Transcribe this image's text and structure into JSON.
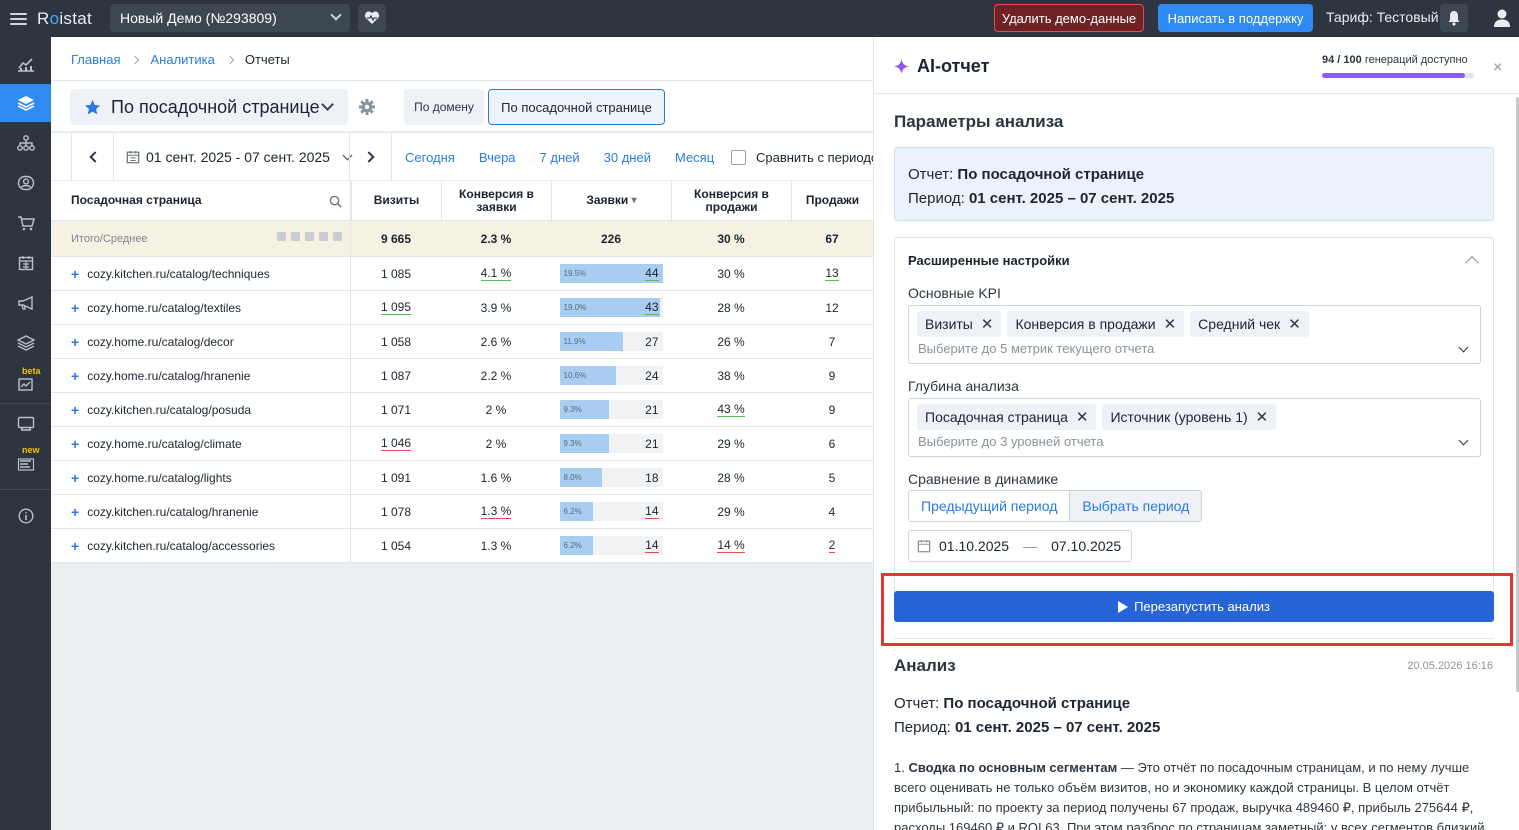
{
  "app": {
    "logo_pre": "R",
    "logo_mid": "o",
    "logo_post": "istat",
    "project": "Новый Демо (№293809)",
    "delete_demo": "Удалить демо-данные",
    "support": "Написать в поддержку",
    "tariff": "Тариф: Тестовый"
  },
  "sidebar": {
    "items": [
      "dashboard-icon",
      "layers-icon",
      "sitemap-icon",
      "leads-icon",
      "cart-icon",
      "calendar-icon",
      "megaphone-icon",
      "stack-icon",
      "ai-chart-icon",
      "bot-icon",
      "list-icon",
      "info-icon"
    ],
    "beta_label": "beta",
    "new_label": "new"
  },
  "breadcrumb": [
    "Главная",
    "Аналитика",
    "Отчеты"
  ],
  "report": {
    "name": "По посадочной странице",
    "tabs": [
      "По домену",
      "По посадочной странице"
    ]
  },
  "daterange": {
    "label": "01 сент. 2025 - 07 сент. 2025",
    "quick": [
      "Сегодня",
      "Вчера",
      "7 дней",
      "30 дней",
      "Месяц"
    ],
    "compare": "Сравнить с периодом"
  },
  "table": {
    "headers": [
      "Посадочная страница",
      "Визиты",
      "Конверсия в заявки",
      "Заявки",
      "Конверсия в продажи",
      "Продажи"
    ],
    "sort_mark": "▾",
    "total": {
      "label": "Итого/Среднее",
      "visits": "9 665",
      "conv_leads": "2.3 %",
      "leads": "226",
      "conv_sales": "30 %",
      "sales": "67"
    },
    "rows": [
      {
        "page": "cozy.kitchen.ru/catalog/techniques",
        "visits": "1 085",
        "conv_leads": "4.1 %",
        "leads_pct": "19.5%",
        "leads": "44",
        "leads_frac": 0.195,
        "conv_sales": "30 %",
        "sales": "13"
      },
      {
        "page": "cozy.home.ru/catalog/textiles",
        "visits": "1 095",
        "conv_leads": "3.9 %",
        "leads_pct": "19.0%",
        "leads": "43",
        "leads_frac": 0.19,
        "conv_sales": "28 %",
        "sales": "12"
      },
      {
        "page": "cozy.home.ru/catalog/decor",
        "visits": "1 058",
        "conv_leads": "2.6 %",
        "leads_pct": "11.9%",
        "leads": "27",
        "leads_frac": 0.119,
        "conv_sales": "26 %",
        "sales": "7"
      },
      {
        "page": "cozy.home.ru/catalog/hranenie",
        "visits": "1 087",
        "conv_leads": "2.2 %",
        "leads_pct": "10.6%",
        "leads": "24",
        "leads_frac": 0.106,
        "conv_sales": "38 %",
        "sales": "9"
      },
      {
        "page": "cozy.kitchen.ru/catalog/posuda",
        "visits": "1 071",
        "conv_leads": "2 %",
        "leads_pct": "9.3%",
        "leads": "21",
        "leads_frac": 0.093,
        "conv_sales": "43 %",
        "sales": "9"
      },
      {
        "page": "cozy.home.ru/catalog/climate",
        "visits": "1 046",
        "conv_leads": "2 %",
        "leads_pct": "9.3%",
        "leads": "21",
        "leads_frac": 0.093,
        "conv_sales": "29 %",
        "sales": "6"
      },
      {
        "page": "cozy.home.ru/catalog/lights",
        "visits": "1 091",
        "conv_leads": "1.6 %",
        "leads_pct": "8.0%",
        "leads": "18",
        "leads_frac": 0.08,
        "conv_sales": "28 %",
        "sales": "5"
      },
      {
        "page": "cozy.kitchen.ru/catalog/hranenie",
        "visits": "1 078",
        "conv_leads": "1.3 %",
        "leads_pct": "6.2%",
        "leads": "14",
        "leads_frac": 0.062,
        "conv_sales": "29 %",
        "sales": "4"
      },
      {
        "page": "cozy.kitchen.ru/catalog/accessories",
        "visits": "1 054",
        "conv_leads": "1.3 %",
        "leads_pct": "6.2%",
        "leads": "14",
        "leads_frac": 0.062,
        "conv_sales": "14 %",
        "sales": "2"
      }
    ]
  },
  "ai": {
    "title": "AI-отчет",
    "gen_count": "94 / 100",
    "gen_text": "генераций доступно",
    "gen_frac": 0.94,
    "close": "×",
    "params_title": "Параметры анализа",
    "report_label": "Отчет:",
    "report_value": "По посадочной странице",
    "period_label": "Период:",
    "period_value": "01 сент. 2025 – 07 сент. 2025",
    "advanced_title": "Расширенные настройки",
    "kpi_label": "Основные KPI",
    "kpi_chips": [
      "Визиты",
      "Конверсия в продажи",
      "Средний чек"
    ],
    "kpi_placeholder": "Выберите до 5 метрик текущего отчета",
    "depth_label": "Глубина анализа",
    "depth_chips": [
      "Посадочная страница",
      "Источник (уровень 1)"
    ],
    "depth_placeholder": "Выберите до 3 уровней отчета",
    "dynamic_label": "Сравнение в динамике",
    "dynamic_options": [
      "Предыдущий период",
      "Выбрать период"
    ],
    "date_from": "01.10.2025",
    "date_sep": "—",
    "date_to": "07.10.2025",
    "run_button": "Перезапустить анализ",
    "analysis_title": "Анализ",
    "analysis_ts": "20.05.2026 16:16",
    "analysis_report_label": "Отчет:",
    "analysis_report_value": "По посадочной странице",
    "analysis_period_label": "Период:",
    "analysis_period_value": "01 сент. 2025 – 07 сент. 2025",
    "analysis_p1_num": "1.",
    "analysis_p1_bold": "Сводка по основным сегментам",
    "analysis_p1_text": " — Это отчёт по посадочным страницам, и по нему лучше всего оценивать не только объём визитов, но и экономику каждой страницы. В целом отчёт прибыльный: по проекту за период получены 67 продаж, выручка 489460 ₽, прибыль 275644 ₽, расходы 169460 ₽ и ROI 63. При этом разброс по страницам заметный: у всех сегментов близкий"
  },
  "colors": {
    "accent": "#2f8bf2",
    "run": "#2764d8",
    "danger": "#e5372d",
    "topbar": "#2d3640"
  }
}
